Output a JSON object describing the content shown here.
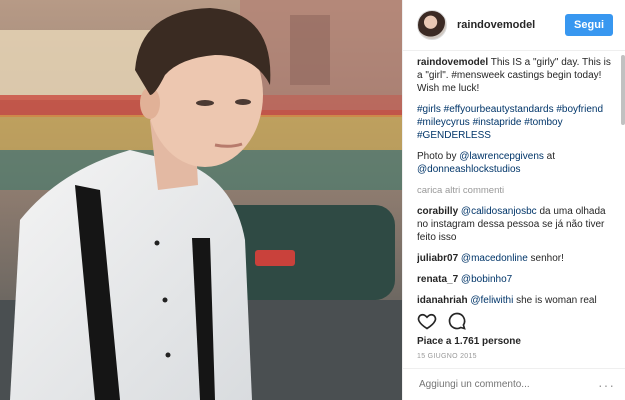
{
  "post": {
    "username": "raindovemodel",
    "follow_label": "Segui",
    "caption_user": "raindovemodel",
    "caption_text": "This IS a \"girly\" day. This is a \"girl\". #mensweek castings begin today! Wish me luck!",
    "hashtags": "#girls #effyourbeautystandards #boyfriend #mileycyrus #instapride #tomboy #GENDERLESS",
    "photo_credit_prefix": "Photo by ",
    "photo_credit_user": "@lawrencepgivens",
    "photo_credit_mid": " at ",
    "photo_credit_studio": "@donneashlockstudios",
    "load_more": "carica altri commenti"
  },
  "comments": [
    {
      "user": "corabilly",
      "mention": "@calidosanjosbc",
      "text": " da uma olhada no instagram dessa pessoa se já não tiver feito isso"
    },
    {
      "user": "juliabr07",
      "mention": "@macedonline",
      "text": " senhor!"
    },
    {
      "user": "renata_7",
      "mention": "@bobinho7",
      "text": ""
    },
    {
      "user": "idanahriah",
      "mention": "@feliwithi",
      "text": " she is woman real woman look at all her pics"
    }
  ],
  "likes": "Piace a 1.761 persone",
  "date": "15 GIUGNO 2015",
  "add_comment_placeholder": "Aggiungi un commento...",
  "more_label": "···",
  "icons": {
    "like": "heart-icon",
    "comment": "comment-icon",
    "more": "more-icon"
  },
  "colors": {
    "accent": "#3897f0",
    "link": "#003569"
  }
}
